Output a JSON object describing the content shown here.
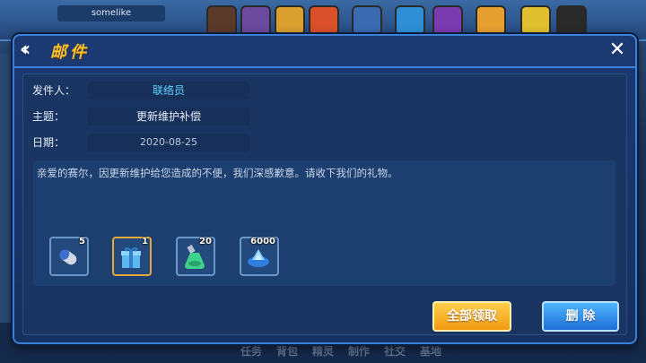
{
  "background": {
    "player_name": "somelike",
    "bottom_nav": [
      "任务",
      "背包",
      "精灵",
      "制作",
      "社交",
      "基地"
    ]
  },
  "dialog": {
    "title": "邮件",
    "fields": {
      "sender_label": "发件人：",
      "sender_value": "联络员",
      "subject_label": "主题：",
      "subject_value": "更新维护补偿",
      "date_label": "日期：",
      "date_value": "2020-08-25"
    },
    "message": "亲爱的赛尔，因更新维护给您造成的不便，我们深感歉意。请收下我们的礼物。",
    "attachments": [
      {
        "icon": "capsule-icon",
        "count": "5"
      },
      {
        "icon": "gift-box-icon",
        "count": "1"
      },
      {
        "icon": "potion-flask-icon",
        "count": "20"
      },
      {
        "icon": "gem-crystal-icon",
        "count": "6000"
      }
    ],
    "buttons": {
      "claim_all": "全部领取",
      "delete": "删 除"
    }
  },
  "colors": {
    "title": "#ffc22e",
    "sender": "#5fd3ff",
    "claim_button": "#f19b12",
    "delete_button": "#1f6fd6"
  }
}
